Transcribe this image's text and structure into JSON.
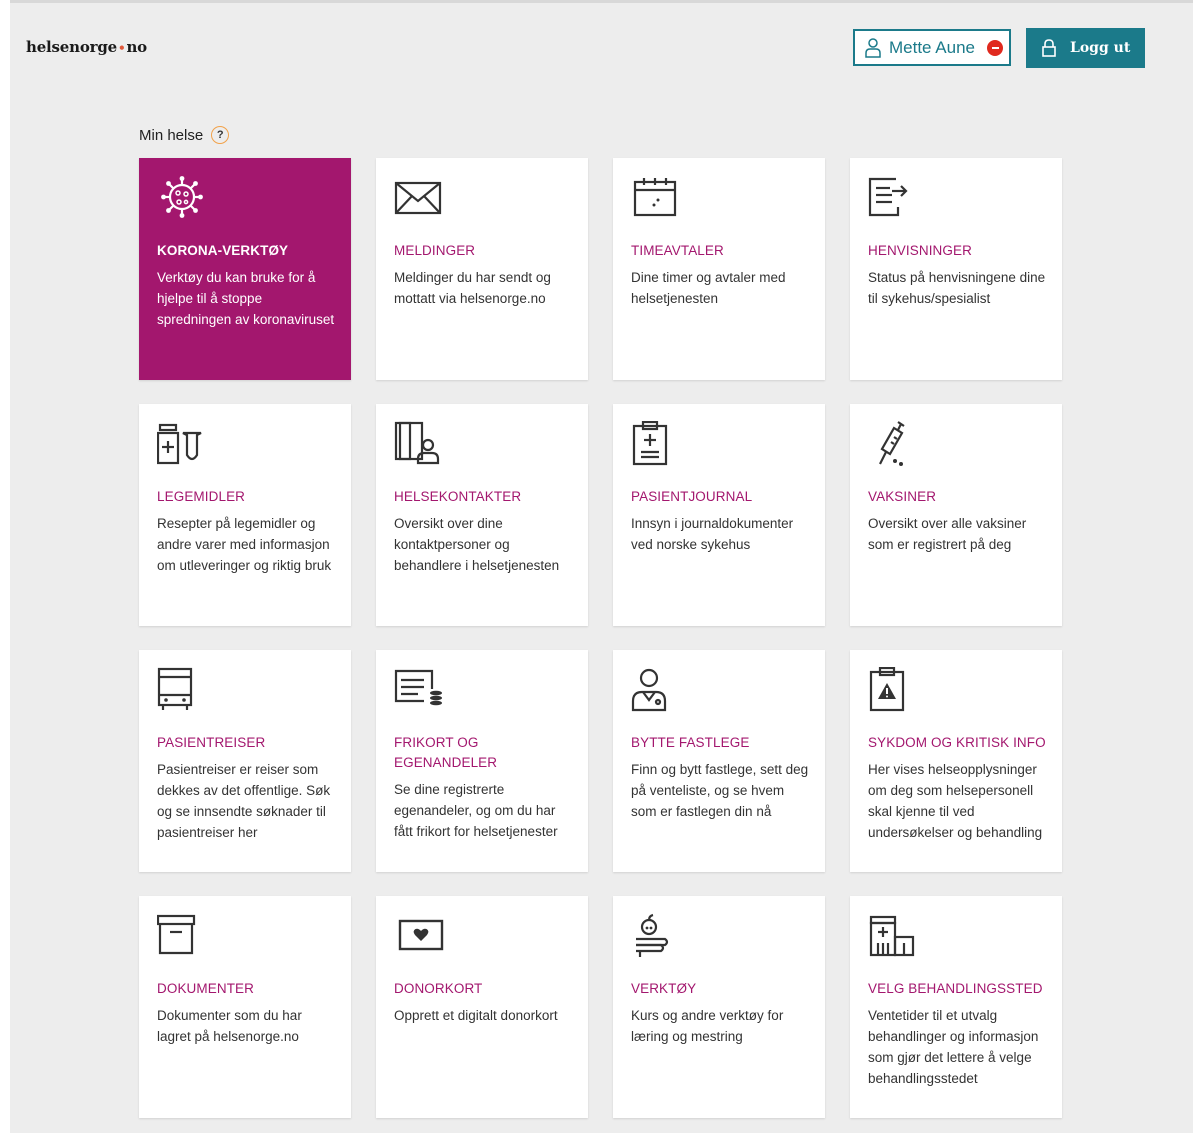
{
  "header": {
    "logo_left": "helsenorge",
    "logo_dot": "•",
    "logo_right": "no",
    "user_name": "Mette Aune",
    "logout_label": "Logg ut"
  },
  "section": {
    "title": "Min helse",
    "help": "?"
  },
  "colors": {
    "accent": "#a3176e",
    "teal": "#1b7a8a",
    "alert": "#e0291e"
  },
  "cards": [
    {
      "icon": "virus-icon",
      "title": "KORONA-VERKTØY",
      "desc": "Verktøy du kan bruke for å hjelpe til å stoppe spredningen av koronaviruset"
    },
    {
      "icon": "envelope-icon",
      "title": "MELDINGER",
      "desc": "Meldinger du har sendt og mottatt via helsenorge.no"
    },
    {
      "icon": "calendar-icon",
      "title": "TIMEAVTALER",
      "desc": "Dine timer og avtaler med helsetjenesten"
    },
    {
      "icon": "referral-icon",
      "title": "HENVISNINGER",
      "desc": "Status på henvisningene dine til sykehus/spesialist"
    },
    {
      "icon": "medicine-icon",
      "title": "LEGEMIDLER",
      "desc": "Resepter på legemidler og andre varer med informasjon om utleveringer og riktig bruk"
    },
    {
      "icon": "contacts-icon",
      "title": "HELSEKONTAKTER",
      "desc": "Oversikt over dine kontaktpersoner og behandlere i helsetjenesten"
    },
    {
      "icon": "clipboard-icon",
      "title": "PASIENTJOURNAL",
      "desc": "Innsyn i journaldokumenter ved norske sykehus"
    },
    {
      "icon": "syringe-icon",
      "title": "VAKSINER",
      "desc": "Oversikt over alle vaksiner som er registrert på deg"
    },
    {
      "icon": "bus-icon",
      "title": "PASIENTREISER",
      "desc": "Pasientreiser er reiser som dekkes av det offentlige. Søk og se innsendte søknader til pasientreiser her"
    },
    {
      "icon": "invoice-icon",
      "title": "FRIKORT OG EGENANDELER",
      "desc": "Se dine registrerte egenandeler, og om du har fått frikort for helsetjenester"
    },
    {
      "icon": "doctor-icon",
      "title": "BYTTE FASTLEGE",
      "desc": "Finn og bytt fastlege, sett deg på venteliste, og se hvem som er fastlegen din nå"
    },
    {
      "icon": "warning-clipboard-icon",
      "title": "SYKDOM OG KRITISK INFO",
      "desc": "Her vises helseopplysninger om deg som helsepersonell skal kjenne til ved undersøkelser og behandling"
    },
    {
      "icon": "archive-icon",
      "title": "DOKUMENTER",
      "desc": "Dokumenter som du har lagret på helsenorge.no"
    },
    {
      "icon": "donor-card-icon",
      "title": "DONORKORT",
      "desc": "Opprett et digitalt donorkort"
    },
    {
      "icon": "apple-books-icon",
      "title": "VERKTØY",
      "desc": "Kurs og andre verktøy for læring og mestring"
    },
    {
      "icon": "hospital-icon",
      "title": "VELG BEHANDLINGSSTED",
      "desc": "Ventetider til et utvalg behandlinger og informasjon som gjør det lettere å velge behandlingsstedet"
    }
  ]
}
